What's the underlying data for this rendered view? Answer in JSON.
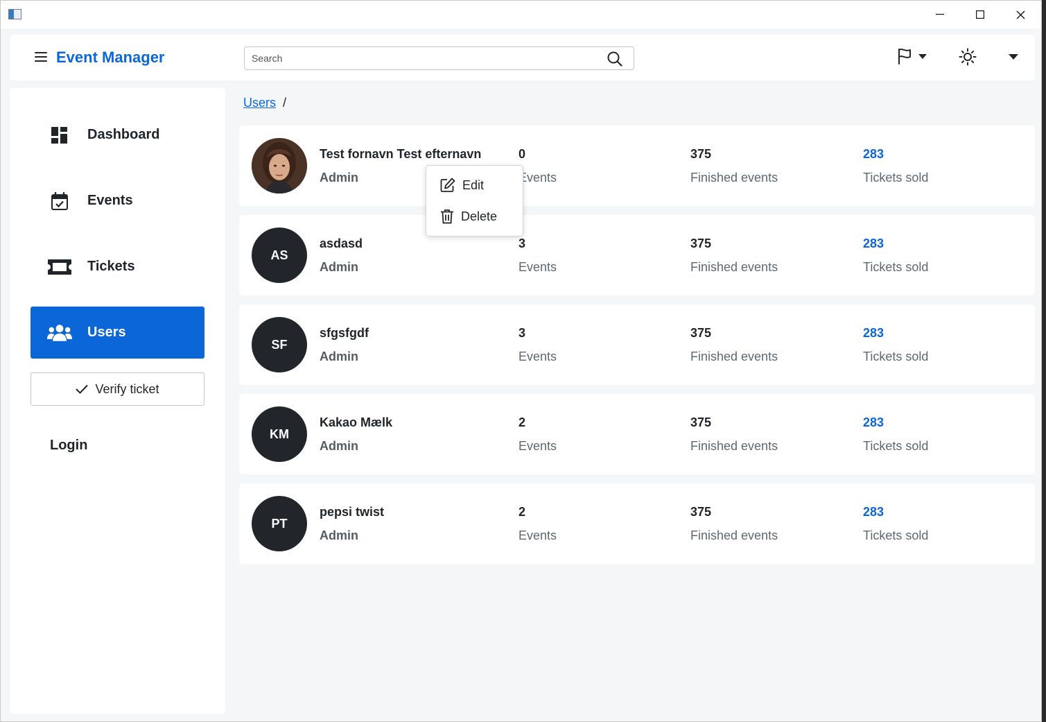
{
  "window": {
    "controls": [
      "minimize",
      "maximize",
      "close"
    ]
  },
  "topbar": {
    "brand": "Event Manager",
    "search_placeholder": "Search"
  },
  "sidebar": {
    "items": [
      {
        "label": "Dashboard",
        "icon": "dashboard-icon"
      },
      {
        "label": "Events",
        "icon": "calendar-check-icon"
      },
      {
        "label": "Tickets",
        "icon": "ticket-icon"
      },
      {
        "label": "Users",
        "icon": "users-icon",
        "active": true
      }
    ],
    "verify_label": "Verify ticket",
    "login_label": "Login"
  },
  "breadcrumb": {
    "link": "Users",
    "separator": "/"
  },
  "users": [
    {
      "name": "Test fornavn Test efternavn",
      "role": "Admin",
      "initials": "",
      "photo": true,
      "events": "0",
      "events_label": "Events",
      "finished": "375",
      "finished_label": "Finished events",
      "tickets": "283",
      "tickets_label": "Tickets sold"
    },
    {
      "name": "asdasd",
      "role": "Admin",
      "initials": "AS",
      "events": "3",
      "events_label": "Events",
      "finished": "375",
      "finished_label": "Finished events",
      "tickets": "283",
      "tickets_label": "Tickets sold"
    },
    {
      "name": "sfgsfgdf",
      "role": "Admin",
      "initials": "SF",
      "events": "3",
      "events_label": "Events",
      "finished": "375",
      "finished_label": "Finished events",
      "tickets": "283",
      "tickets_label": "Tickets sold"
    },
    {
      "name": "Kakao Mælk",
      "role": "Admin",
      "initials": "KM",
      "events": "2",
      "events_label": "Events",
      "finished": "375",
      "finished_label": "Finished events",
      "tickets": "283",
      "tickets_label": "Tickets sold"
    },
    {
      "name": "pepsi twist",
      "role": "Admin",
      "initials": "PT",
      "events": "2",
      "events_label": "Events",
      "finished": "375",
      "finished_label": "Finished events",
      "tickets": "283",
      "tickets_label": "Tickets sold"
    }
  ],
  "context_menu": {
    "edit": "Edit",
    "delete": "Delete"
  },
  "colors": {
    "accent": "#0b66d8",
    "avatar_bg": "#22262b",
    "page_bg": "#f5f6f8"
  }
}
